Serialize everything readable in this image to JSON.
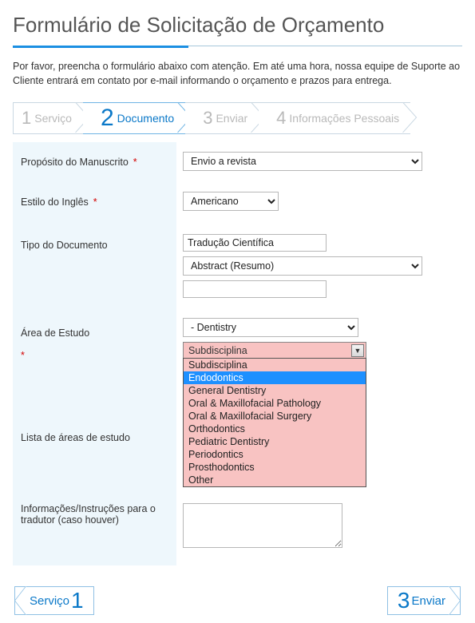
{
  "title": "Formulário de Solicitação de Orçamento",
  "intro": "Por favor, preencha o formulário abaixo com atenção. Em até uma hora, nossa equipe de Suporte ao Cliente entrará em contato por e-mail informando o orçamento e prazos para entrega.",
  "steps": [
    {
      "num": "1",
      "label": "Serviço"
    },
    {
      "num": "2",
      "label": "Documento"
    },
    {
      "num": "3",
      "label": "Enviar"
    },
    {
      "num": "4",
      "label": "Informações Pessoais"
    }
  ],
  "active_step": 1,
  "labels": {
    "purpose": "Propósito do Manuscrito",
    "english_style": "Estilo do Inglês",
    "doc_type": "Tipo do Documento",
    "study_area": "Área de Estudo",
    "study_list": "Lista de áreas de estudo",
    "instructions": "Informações/Instruções para o tradutor (caso houver)"
  },
  "required_marker": "*",
  "fields": {
    "purpose_value": "Envio a revista",
    "english_style_value": "Americano",
    "doc_type_text_value": "Tradução Científica",
    "doc_type_select_value": "Abstract (Resumo)",
    "doc_type_extra_value": "",
    "study_area_value": "- Dentistry",
    "subdiscipline_selected": "Subdisciplina",
    "subdiscipline_highlight": "Endodontics",
    "subdiscipline_options": [
      "Subdisciplina",
      "Endodontics",
      "General Dentistry",
      "Oral & Maxillofacial Pathology",
      "Oral & Maxillofacial Surgery",
      "Orthodontics",
      "Pediatric Dentistry",
      "Periodontics",
      "Prosthodontics",
      "Other"
    ],
    "instructions_value": ""
  },
  "nav": {
    "prev_label": "Serviço",
    "prev_num": "1",
    "next_label": "Enviar",
    "next_num": "3"
  }
}
